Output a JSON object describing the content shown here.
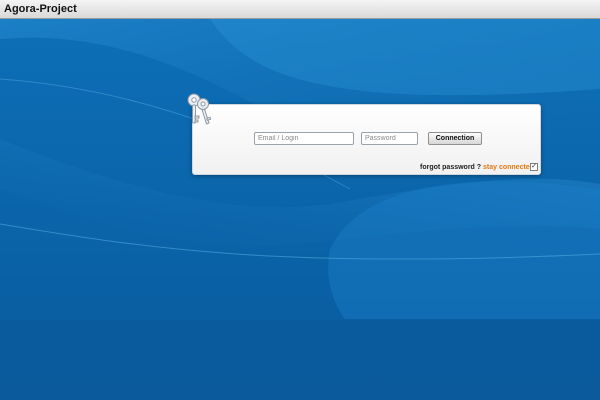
{
  "window": {
    "title": "Agora-Project"
  },
  "login": {
    "email_placeholder": "Email / Login",
    "password_placeholder": "Password",
    "connect_label": "Connection",
    "forgot_label": "forgot password ?",
    "stay_label": "stay connected",
    "stay_checked": true,
    "check_glyph": "✓"
  },
  "icons": {
    "login_icon": "keys-icon",
    "checkbox_icon": "checkmark-icon"
  },
  "colors": {
    "background": "#0a5fa3",
    "accent_link": "#e07a12",
    "panel": "#ffffff"
  }
}
